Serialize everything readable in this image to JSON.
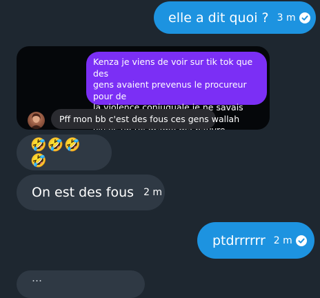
{
  "messages": {
    "m1": {
      "text": "elle a dit quoi ?",
      "time": "3 m",
      "status_icon": "read-check-icon"
    },
    "story": {
      "quoted_message": "Kenza je viens de voir sur tik tok que des\ngens avaient prevenus le procureur pour de\nla violence conjuguale je ne savais pas que tu\nvivais un tel drame ma pauvre reconstruit toi",
      "reply_text": "Pff mon bb c'est des fous ces gens wallah"
    },
    "m2": {
      "text": "🤣🤣🤣🤣"
    },
    "m3": {
      "text": "On est des fous",
      "time": "2 m"
    },
    "m4": {
      "text": "ptdrrrrrr",
      "time": "2 m",
      "status_icon": "read-check-icon"
    },
    "m5": {
      "text": "…"
    }
  },
  "colors": {
    "background": "#1e2730",
    "outgoing_bubble": "#1d93e0",
    "incoming_bubble": "#2f3944",
    "story_quote": "#7b2ff5"
  }
}
